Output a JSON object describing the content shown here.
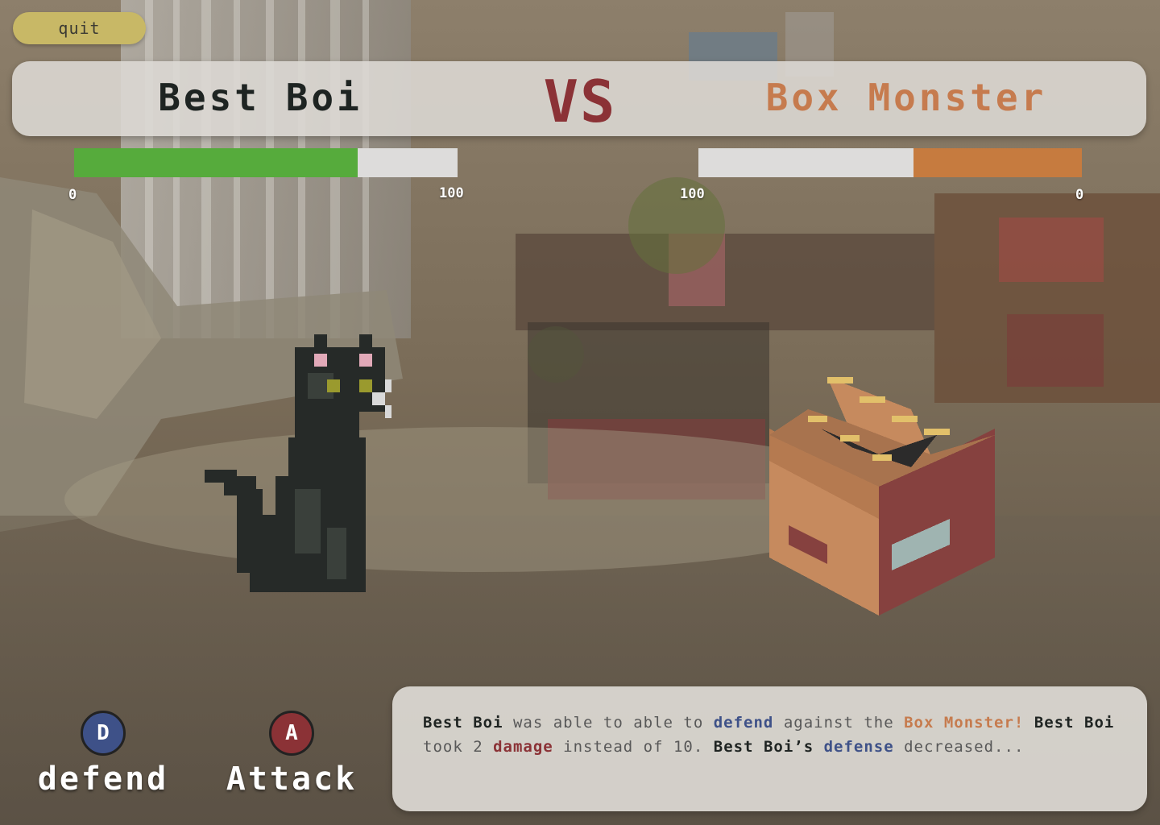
{
  "quit_label": "quit",
  "header": {
    "player_name": "Best Boi",
    "vs_label": "VS",
    "enemy_name": "Box Monster"
  },
  "player_hp": {
    "min_label": "0",
    "max_label": "100",
    "fraction": 0.74,
    "color": "#56ab3c"
  },
  "enemy_hp": {
    "max_label": "100",
    "min_label": "0",
    "fraction": 0.44,
    "color": "#c67b3f"
  },
  "actions": {
    "defend": {
      "key": "D",
      "label": "defend",
      "color": "#3e5188"
    },
    "attack": {
      "key": "A",
      "label": "Attack",
      "color": "#8b3236"
    }
  },
  "message": {
    "parts": [
      {
        "text": "Best Boi",
        "style": "name"
      },
      {
        "text": " was able to able to ",
        "style": "plain"
      },
      {
        "text": "defend",
        "style": "blue"
      },
      {
        "text": " against the ",
        "style": "plain"
      },
      {
        "text": "Box Monster!",
        "style": "enemy"
      },
      {
        "text": " ",
        "style": "plain"
      },
      {
        "text": "Best Boi",
        "style": "name"
      },
      {
        "text": " took 2 ",
        "style": "plain"
      },
      {
        "text": "damage",
        "style": "red"
      },
      {
        "text": " instead of 10. ",
        "style": "plain"
      },
      {
        "text": "Best Boi’s",
        "style": "name"
      },
      {
        "text": " ",
        "style": "plain"
      },
      {
        "text": "defense",
        "style": "blue"
      },
      {
        "text": " decreased...",
        "style": "plain"
      }
    ]
  },
  "sprites": {
    "player": "black-cat-sprite",
    "enemy": "box-monster-sprite"
  }
}
